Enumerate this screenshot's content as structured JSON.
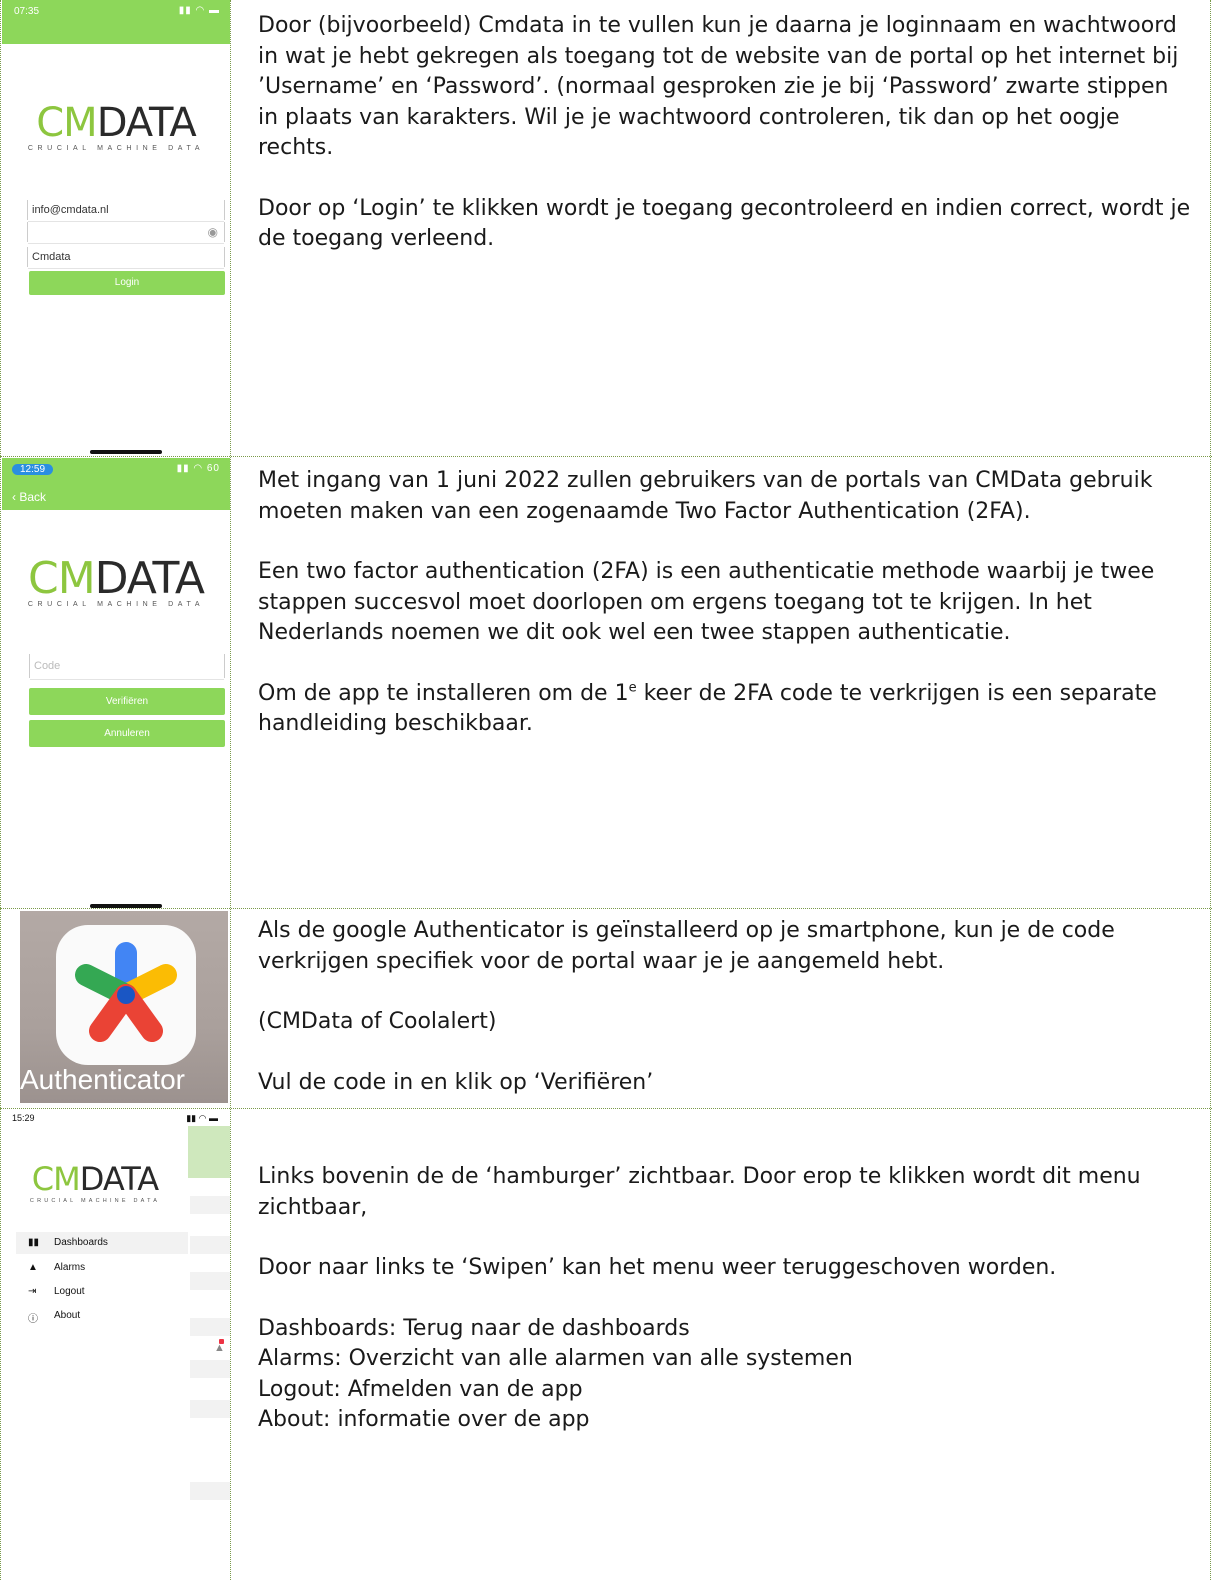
{
  "rows": [
    {
      "screen": {
        "time": "07:35",
        "status_icons": "▮▮ ◠ ▬",
        "logo_left": "CM",
        "logo_right": "DATA",
        "logo_tagline": "CRUCIAL MACHINE DATA",
        "username_value": "info@cmdata.nl",
        "password_value": "",
        "eye_icon": "eye-icon",
        "portal_value": "Cmdata",
        "login_label": "Login"
      },
      "paragraphs": [
        "Door (bijvoorbeeld) Cmdata in te vullen kun je daarna je loginnaam en wachtwoord in wat je hebt gekregen als toegang tot de website van de portal op het internet bij ’Username’ en ‘Password’. (normaal gesproken zie je bij ‘Password’ zwarte stippen in plaats van karakters. Wil je je wachtwoord controleren, tik dan op het oogje rechts.",
        "Door op ‘Login’ te klikken wordt je toegang gecontroleerd en indien correct, wordt je de toegang verleend."
      ]
    },
    {
      "screen": {
        "time": "12:59",
        "status_icons": "▮▮ ◠ 60",
        "back_label": "Back",
        "logo_left": "CM",
        "logo_right": "DATA",
        "logo_tagline": "CRUCIAL MACHINE DATA",
        "code_placeholder": "Code",
        "verify_label": "Verifiëren",
        "cancel_label": "Annuleren"
      },
      "paragraphs": [
        "Met ingang van 1 juni 2022 zullen gebruikers van de portals van CMData gebruik moeten maken van een zogenaamde Two Factor Authentication (2FA).",
        "Een two factor authentication (2FA) is een authenticatie methode waarbij je twee stappen succesvol moet doorlopen om ergens toegang tot te krijgen. In het Nederlands noemen we dit ook wel een twee stappen authenticatie."
      ],
      "p3_a": "Om de app te installeren om de 1",
      "p3_sup": "e",
      "p3_b": " keer de 2FA code te verkrijgen is een separate handleiding beschikbaar."
    },
    {
      "app_label": "Authenticator",
      "paragraphs": [
        "Als de google Authenticator is geïnstalleerd op je smartphone, kun je de code verkrijgen specifiek voor de portal waar je je aangemeld hebt.",
        "(CMData of Coolalert)",
        "Vul de code in en klik op ‘Verifiëren’"
      ]
    },
    {
      "screen": {
        "time": "15:29",
        "status_icons": "▮▮ ◠ ▬",
        "logo_left": "CM",
        "logo_right": "DATA",
        "logo_tagline": "CRUCIAL MACHINE DATA",
        "menu": [
          {
            "icon": "▮▮",
            "label": "Dashboards"
          },
          {
            "icon": "🔔",
            "label": "Alarms"
          },
          {
            "icon": "⇥",
            "label": "Logout"
          },
          {
            "icon": "ⓘ",
            "label": "About"
          }
        ]
      },
      "paragraphs": [
        "Links bovenin de de ‘hamburger’ zichtbaar. Door erop te klikken wordt dit menu zichtbaar,",
        "Door naar links te ‘Swipen’ kan het menu weer teruggeschoven worden."
      ],
      "definitions": [
        "Dashboards: Terug naar de dashboards",
        "Alarms: Overzicht van alle alarmen van alle systemen",
        "Logout: Afmelden van de app",
        "About: informatie over de app"
      ]
    }
  ]
}
